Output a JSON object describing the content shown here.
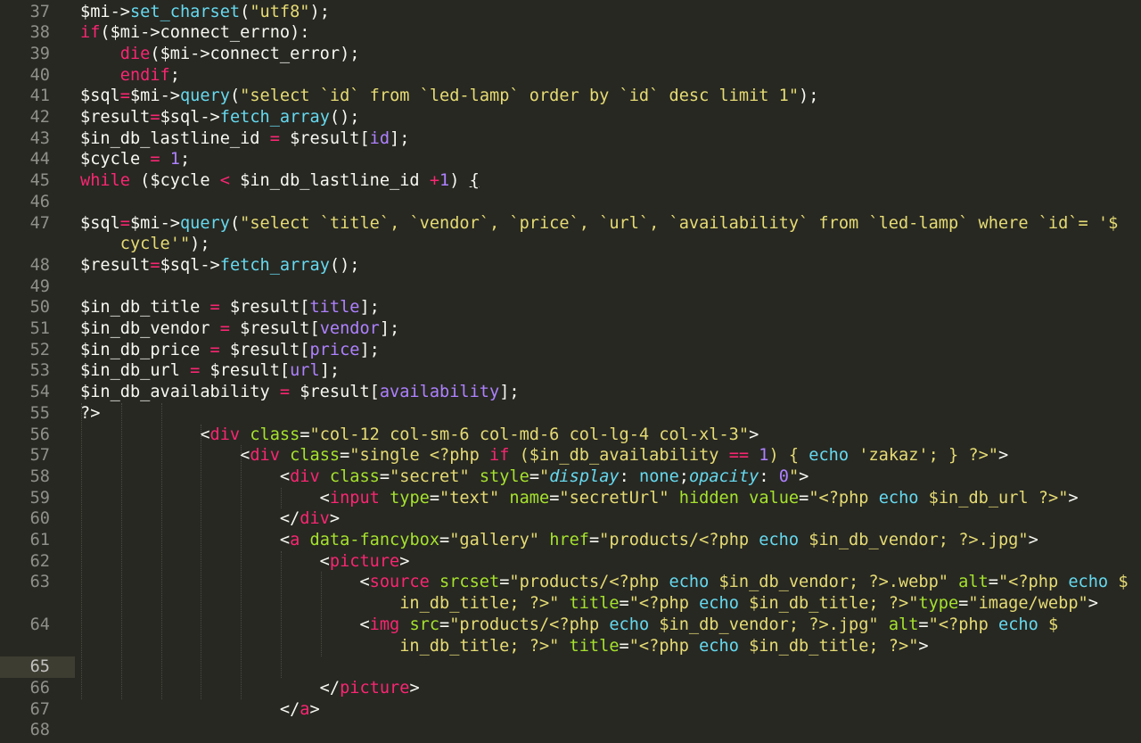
{
  "editor": {
    "theme_colors": {
      "background": "#272822",
      "plain": "#f8f8f2",
      "keyword": "#f92672",
      "function": "#66d9ef",
      "string": "#e6db74",
      "number": "#ae81ff",
      "attribute": "#a6e22e",
      "gutter": "#8f908a"
    },
    "current_line": "65",
    "lines": [
      {
        "n": "37",
        "wrap": [
          [
            [
              "plain",
              "$mi->"
            ],
            [
              "fn",
              "set_charset"
            ],
            [
              "plain",
              "("
            ],
            [
              "str",
              "\"utf8\""
            ],
            [
              "plain",
              ");"
            ]
          ]
        ]
      },
      {
        "n": "38",
        "wrap": [
          [
            [
              "kw",
              "if"
            ],
            [
              "plain",
              "($mi->connect_errno):"
            ]
          ]
        ]
      },
      {
        "n": "39",
        "wrap": [
          [
            [
              "plain",
              "    "
            ],
            [
              "kw",
              "die"
            ],
            [
              "plain",
              "($mi->connect_error);"
            ]
          ]
        ]
      },
      {
        "n": "40",
        "wrap": [
          [
            [
              "plain",
              "    "
            ],
            [
              "kw",
              "endif"
            ],
            [
              "plain",
              ";"
            ]
          ]
        ]
      },
      {
        "n": "41",
        "wrap": [
          [
            [
              "plain",
              "$sql"
            ],
            [
              "kw",
              "="
            ],
            [
              "plain",
              "$mi->"
            ],
            [
              "fn",
              "query"
            ],
            [
              "plain",
              "("
            ],
            [
              "str",
              "\"select `id` from `led-lamp` order by `id` desc limit 1\""
            ],
            [
              "plain",
              ");"
            ]
          ]
        ]
      },
      {
        "n": "42",
        "wrap": [
          [
            [
              "plain",
              "$result"
            ],
            [
              "kw",
              "="
            ],
            [
              "plain",
              "$sql->"
            ],
            [
              "fn",
              "fetch_array"
            ],
            [
              "plain",
              "();"
            ]
          ]
        ]
      },
      {
        "n": "43",
        "wrap": [
          [
            [
              "plain",
              "$in_db_lastline_id "
            ],
            [
              "kw",
              "="
            ],
            [
              "plain",
              " $result["
            ],
            [
              "num",
              "id"
            ],
            [
              "plain",
              "];"
            ]
          ]
        ]
      },
      {
        "n": "44",
        "wrap": [
          [
            [
              "plain",
              "$cycle "
            ],
            [
              "kw",
              "="
            ],
            [
              "plain",
              " "
            ],
            [
              "num",
              "1"
            ],
            [
              "plain",
              ";"
            ]
          ]
        ]
      },
      {
        "n": "45",
        "wrap": [
          [
            [
              "kw",
              "while"
            ],
            [
              "plain",
              " ($cycle "
            ],
            [
              "kw",
              "<"
            ],
            [
              "plain",
              " $in_db_lastline_id "
            ],
            [
              "kw",
              "+"
            ],
            [
              "num",
              "1"
            ],
            [
              "plain",
              ") "
            ],
            [
              "brace",
              "{"
            ]
          ]
        ]
      },
      {
        "n": "46",
        "wrap": [
          []
        ]
      },
      {
        "n": "47",
        "wrap": [
          [
            [
              "plain",
              "$sql"
            ],
            [
              "kw",
              "="
            ],
            [
              "plain",
              "$mi->"
            ],
            [
              "fn",
              "query"
            ],
            [
              "plain",
              "("
            ],
            [
              "str",
              "\"select `title`, `vendor`, `price`, `url`, `availability` from `led-lamp` where `id`= '$"
            ]
          ],
          [
            [
              "str",
              "    cycle'\""
            ],
            [
              "plain",
              ");"
            ]
          ]
        ]
      },
      {
        "n": "48",
        "wrap": [
          [
            [
              "plain",
              "$result"
            ],
            [
              "kw",
              "="
            ],
            [
              "plain",
              "$sql->"
            ],
            [
              "fn",
              "fetch_array"
            ],
            [
              "plain",
              "();"
            ]
          ]
        ]
      },
      {
        "n": "49",
        "wrap": [
          []
        ]
      },
      {
        "n": "50",
        "wrap": [
          [
            [
              "plain",
              "$in_db_title "
            ],
            [
              "kw",
              "="
            ],
            [
              "plain",
              " $result["
            ],
            [
              "num",
              "title"
            ],
            [
              "plain",
              "];"
            ]
          ]
        ]
      },
      {
        "n": "51",
        "wrap": [
          [
            [
              "plain",
              "$in_db_vendor "
            ],
            [
              "kw",
              "="
            ],
            [
              "plain",
              " $result["
            ],
            [
              "num",
              "vendor"
            ],
            [
              "plain",
              "];"
            ]
          ]
        ]
      },
      {
        "n": "52",
        "wrap": [
          [
            [
              "plain",
              "$in_db_price "
            ],
            [
              "kw",
              "="
            ],
            [
              "plain",
              " $result["
            ],
            [
              "num",
              "price"
            ],
            [
              "plain",
              "];"
            ]
          ]
        ]
      },
      {
        "n": "53",
        "wrap": [
          [
            [
              "plain",
              "$in_db_url "
            ],
            [
              "kw",
              "="
            ],
            [
              "plain",
              " $result["
            ],
            [
              "num",
              "url"
            ],
            [
              "plain",
              "];"
            ]
          ]
        ]
      },
      {
        "n": "54",
        "wrap": [
          [
            [
              "plain",
              "$in_db_availability "
            ],
            [
              "kw",
              "="
            ],
            [
              "plain",
              " $result["
            ],
            [
              "num",
              "availability"
            ],
            [
              "plain",
              "];"
            ]
          ]
        ]
      },
      {
        "n": "55",
        "wrap": [
          [
            [
              "plain",
              "?>"
            ]
          ]
        ]
      },
      {
        "n": "56",
        "wrap": [
          [
            [
              "plain",
              "            <"
            ],
            [
              "tag",
              "div"
            ],
            [
              "plain",
              " "
            ],
            [
              "attr",
              "class"
            ],
            [
              "plain",
              "="
            ],
            [
              "str",
              "\"col-12 col-sm-6 col-md-6 col-lg-4 col-xl-3\""
            ],
            [
              "plain",
              ">"
            ]
          ]
        ]
      },
      {
        "n": "57",
        "wrap": [
          [
            [
              "plain",
              "                <"
            ],
            [
              "tag",
              "div"
            ],
            [
              "plain",
              " "
            ],
            [
              "attr",
              "class"
            ],
            [
              "plain",
              "="
            ],
            [
              "str",
              "\"single <?php "
            ],
            [
              "kw",
              "if"
            ],
            [
              "str",
              " ($in_db_availability "
            ],
            [
              "kw",
              "=="
            ],
            [
              "str",
              " "
            ],
            [
              "num",
              "1"
            ],
            [
              "str",
              ") { "
            ],
            [
              "fn",
              "echo"
            ],
            [
              "str",
              " 'zakaz'; } ?>\""
            ],
            [
              "plain",
              ">"
            ]
          ]
        ]
      },
      {
        "n": "58",
        "wrap": [
          [
            [
              "plain",
              "                    <"
            ],
            [
              "tag",
              "div"
            ],
            [
              "plain",
              " "
            ],
            [
              "attr",
              "class"
            ],
            [
              "plain",
              "="
            ],
            [
              "str",
              "\"secret\""
            ],
            [
              "plain",
              " "
            ],
            [
              "attr",
              "style"
            ],
            [
              "plain",
              "="
            ],
            [
              "str",
              "\""
            ],
            [
              "ital",
              "display"
            ],
            [
              "plain",
              ": "
            ],
            [
              "fn",
              "none"
            ],
            [
              "plain",
              ";"
            ],
            [
              "ital",
              "opacity"
            ],
            [
              "plain",
              ": "
            ],
            [
              "num",
              "0"
            ],
            [
              "str",
              "\""
            ],
            [
              "plain",
              ">"
            ]
          ]
        ]
      },
      {
        "n": "59",
        "wrap": [
          [
            [
              "plain",
              "                        <"
            ],
            [
              "tag",
              "input"
            ],
            [
              "plain",
              " "
            ],
            [
              "attr",
              "type"
            ],
            [
              "plain",
              "="
            ],
            [
              "str",
              "\"text\""
            ],
            [
              "plain",
              " "
            ],
            [
              "attr",
              "name"
            ],
            [
              "plain",
              "="
            ],
            [
              "str",
              "\"secretUrl\""
            ],
            [
              "plain",
              " "
            ],
            [
              "attr",
              "hidden"
            ],
            [
              "plain",
              " "
            ],
            [
              "attr",
              "value"
            ],
            [
              "plain",
              "="
            ],
            [
              "str",
              "\"<?php "
            ],
            [
              "fn",
              "echo"
            ],
            [
              "str",
              " $in_db_url ?>\""
            ],
            [
              "plain",
              ">"
            ]
          ]
        ]
      },
      {
        "n": "60",
        "wrap": [
          [
            [
              "plain",
              "                    </"
            ],
            [
              "tag",
              "div"
            ],
            [
              "plain",
              ">"
            ]
          ]
        ]
      },
      {
        "n": "61",
        "wrap": [
          [
            [
              "plain",
              "                    <"
            ],
            [
              "tag",
              "a"
            ],
            [
              "plain",
              " "
            ],
            [
              "attr",
              "data-fancybox"
            ],
            [
              "plain",
              "="
            ],
            [
              "str",
              "\"gallery\""
            ],
            [
              "plain",
              " "
            ],
            [
              "attr",
              "href"
            ],
            [
              "plain",
              "="
            ],
            [
              "str",
              "\"products/<?php "
            ],
            [
              "fn",
              "echo"
            ],
            [
              "str",
              " $in_db_vendor; ?>.jpg\""
            ],
            [
              "plain",
              ">"
            ]
          ]
        ]
      },
      {
        "n": "62",
        "wrap": [
          [
            [
              "plain",
              "                        <"
            ],
            [
              "tag",
              "picture"
            ],
            [
              "plain",
              ">"
            ]
          ]
        ]
      },
      {
        "n": "63",
        "wrap": [
          [
            [
              "plain",
              "                            <"
            ],
            [
              "tag",
              "source"
            ],
            [
              "plain",
              " "
            ],
            [
              "attr",
              "srcset"
            ],
            [
              "plain",
              "="
            ],
            [
              "str",
              "\"products/<?php "
            ],
            [
              "fn",
              "echo"
            ],
            [
              "str",
              " $in_db_vendor; ?>.webp\""
            ],
            [
              "plain",
              " "
            ],
            [
              "attr",
              "alt"
            ],
            [
              "plain",
              "="
            ],
            [
              "str",
              "\"<?php "
            ],
            [
              "fn",
              "echo"
            ],
            [
              "str",
              " $"
            ]
          ],
          [
            [
              "str",
              "                                in_db_title; ?>\""
            ],
            [
              "plain",
              " "
            ],
            [
              "attr",
              "title"
            ],
            [
              "plain",
              "="
            ],
            [
              "str",
              "\"<?php "
            ],
            [
              "fn",
              "echo"
            ],
            [
              "str",
              " $in_db_title; ?>\""
            ],
            [
              "attr",
              "type"
            ],
            [
              "plain",
              "="
            ],
            [
              "str",
              "\"image/webp\""
            ],
            [
              "plain",
              ">"
            ]
          ]
        ]
      },
      {
        "n": "64",
        "wrap": [
          [
            [
              "plain",
              "                            <"
            ],
            [
              "tag",
              "img"
            ],
            [
              "plain",
              " "
            ],
            [
              "attr",
              "src"
            ],
            [
              "plain",
              "="
            ],
            [
              "str",
              "\"products/<?php "
            ],
            [
              "fn",
              "echo"
            ],
            [
              "str",
              " $in_db_vendor; ?>.jpg\""
            ],
            [
              "plain",
              " "
            ],
            [
              "attr",
              "alt"
            ],
            [
              "plain",
              "="
            ],
            [
              "str",
              "\"<?php "
            ],
            [
              "fn",
              "echo"
            ],
            [
              "str",
              " $"
            ]
          ],
          [
            [
              "str",
              "                                in_db_title; ?>\""
            ],
            [
              "plain",
              " "
            ],
            [
              "attr",
              "title"
            ],
            [
              "plain",
              "="
            ],
            [
              "str",
              "\"<?php "
            ],
            [
              "fn",
              "echo"
            ],
            [
              "str",
              " $in_db_title; ?>\""
            ],
            [
              "plain",
              ">"
            ]
          ]
        ]
      },
      {
        "n": "65",
        "wrap": [
          []
        ]
      },
      {
        "n": "66",
        "wrap": [
          [
            [
              "plain",
              "                        </"
            ],
            [
              "tag",
              "picture"
            ],
            [
              "plain",
              ">"
            ]
          ]
        ]
      },
      {
        "n": "67",
        "wrap": [
          [
            [
              "plain",
              "                    </"
            ],
            [
              "tag",
              "a"
            ],
            [
              "plain",
              ">"
            ]
          ]
        ]
      },
      {
        "n": "68",
        "wrap": [
          []
        ]
      }
    ]
  }
}
